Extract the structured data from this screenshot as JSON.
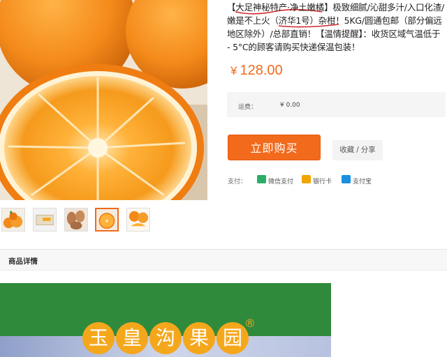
{
  "product": {
    "title_highlight": "【大足神秘特产·净土嫩橘】",
    "title_rest": "极致细腻/沁甜多汁/入口化渣/嫩是不上火（济华1号）杂柑！5KG/圆通包邮（部分偏远地区除外）/总部直销！【温情提醒】：收货区域气温低于 - 5°C的顾客请购买快递保温包装！",
    "currency": "¥",
    "price": "128.00"
  },
  "shipping": {
    "label": "运费：",
    "value": "¥ 0.00"
  },
  "actions": {
    "buy_label": "立即购买",
    "favorite_label": "收藏",
    "share_label": "分享",
    "separator": "/"
  },
  "payment": {
    "label": "支付：",
    "methods": [
      {
        "name": "微信支付",
        "icon": "wechat-pay-icon",
        "color": "#2aae67"
      },
      {
        "name": "银行卡",
        "icon": "bank-card-icon",
        "color": "#f0a500"
      },
      {
        "name": "支付宝",
        "icon": "alipay-icon",
        "color": "#1a8fe3"
      }
    ]
  },
  "thumbnails": {
    "count": 5,
    "active_index": 3
  },
  "details": {
    "tab_label": "商品详情"
  },
  "banner": {
    "brand_chars": [
      "玉",
      "皇",
      "沟",
      "果",
      "园"
    ],
    "registered_mark": "®"
  },
  "colors": {
    "accent": "#f26a1b",
    "banner_green": "#2f8a3c",
    "brand_orange": "#f5a71c"
  }
}
